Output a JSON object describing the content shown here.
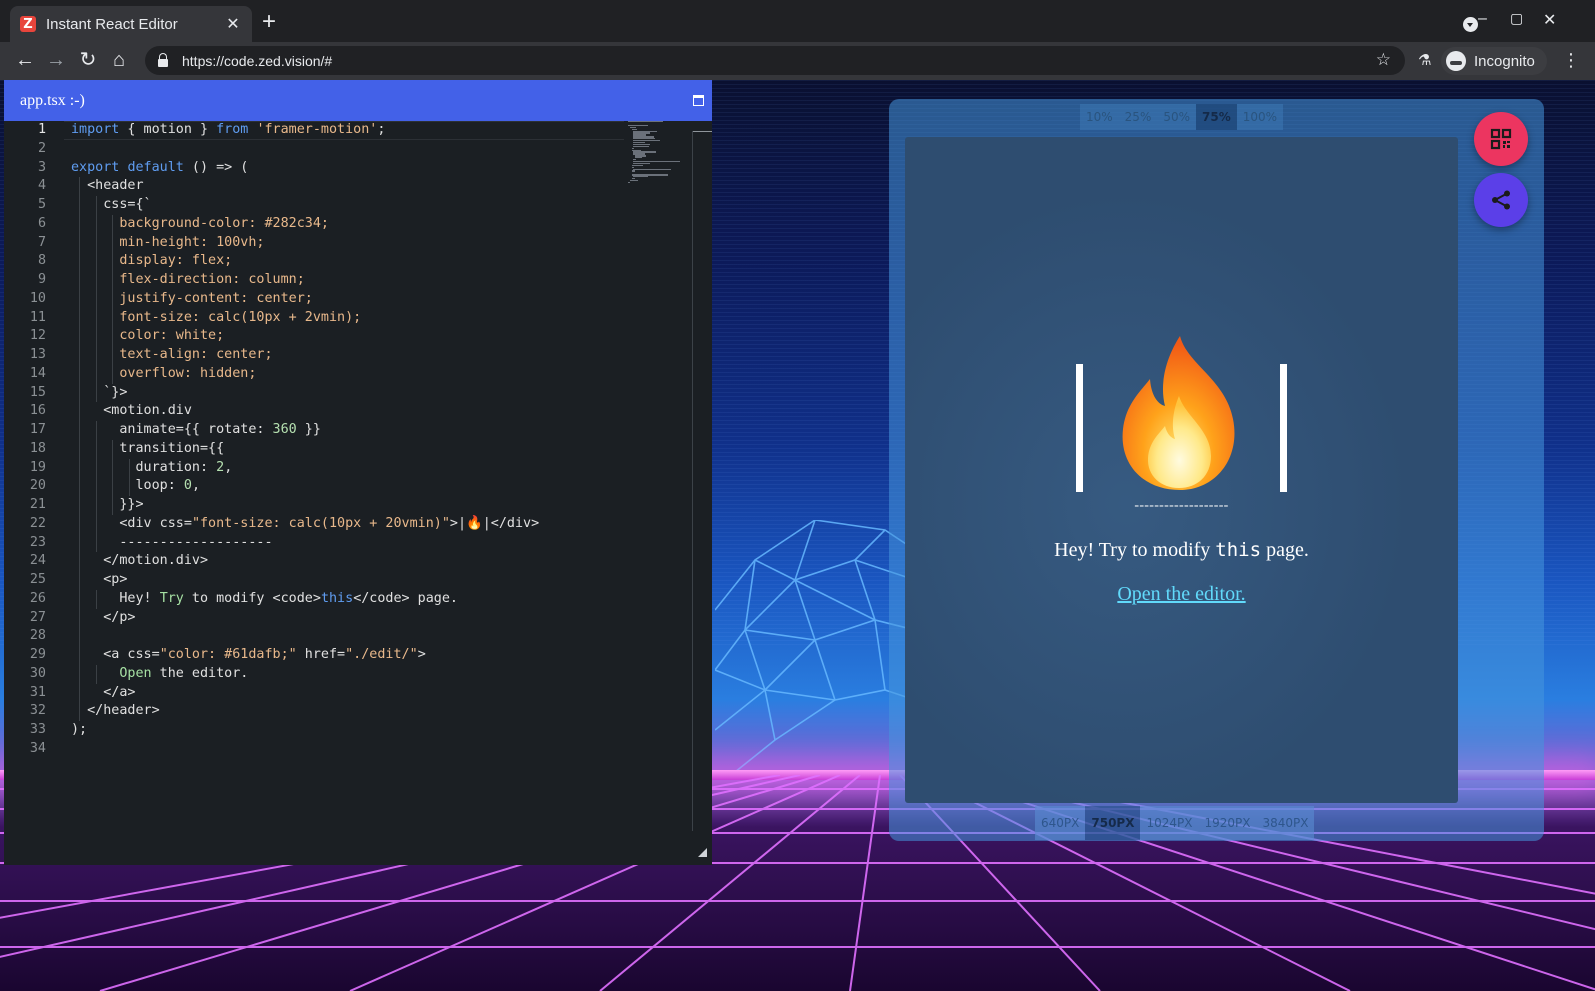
{
  "browser": {
    "tab_title": "Instant React Editor",
    "tab_favicon_letter": "Z",
    "tab_close": "✕",
    "new_tab": "+",
    "url": "https://code.zed.vision/#",
    "profile_label": "Incognito",
    "win_minimize": "–",
    "win_maximize": "▢",
    "win_close": "✕"
  },
  "editor": {
    "file_name": "app.tsx :-)",
    "active_line": 1,
    "line_numbers": [
      "1",
      "2",
      "3",
      "4",
      "5",
      "6",
      "7",
      "8",
      "9",
      "10",
      "11",
      "12",
      "13",
      "14",
      "15",
      "16",
      "17",
      "18",
      "19",
      "20",
      "21",
      "22",
      "23",
      "24",
      "25",
      "26",
      "27",
      "28",
      "29",
      "30",
      "31",
      "32",
      "33",
      "34"
    ],
    "code_lines": [
      "import { motion } from 'framer-motion';",
      "",
      "export default () => (",
      "  <header",
      "    css={`",
      "      background-color: #282c34;",
      "      min-height: 100vh;",
      "      display: flex;",
      "      flex-direction: column;",
      "      justify-content: center;",
      "      font-size: calc(10px + 2vmin);",
      "      color: white;",
      "      text-align: center;",
      "      overflow: hidden;",
      "    `}>",
      "    <motion.div",
      "      animate={{ rotate: 360 }}",
      "      transition={{",
      "        duration: 2,",
      "        loop: 0,",
      "      }}>",
      "      <div css=\"font-size: calc(10px + 20vmin)\">|🔥|</div>",
      "      -------------------",
      "    </motion.div>",
      "    <p>",
      "      Hey! Try to modify <code>this</code> page.",
      "    </p>",
      "",
      "    <a css=\"color: #61dafb;\" href=\"./edit/\">",
      "      Open the editor.",
      "    </a>",
      "  </header>",
      ");",
      ""
    ]
  },
  "preview": {
    "zoom_options": [
      "10%",
      "25%",
      "50%",
      "75%",
      "100%"
    ],
    "zoom_selected": "75%",
    "resolution_options": [
      "640PX",
      "750PX",
      "1024PX",
      "1920PX",
      "3840PX"
    ],
    "resolution_selected": "750PX",
    "content": {
      "fire_emoji": "🔥",
      "dashes": "-------------------",
      "hey_before": "Hey! Try to modify",
      "hey_code": "this",
      "hey_after": "page.",
      "link_text": "Open the editor."
    },
    "fab_qr_icon": "qr-code-icon",
    "fab_share_icon": "share-icon"
  },
  "colors": {
    "editor_header": "#4361e8",
    "editor_bg": "#1b1f23",
    "link": "#61dafb",
    "qr_button": "#ec3560",
    "share_button": "#5b3fe8"
  }
}
